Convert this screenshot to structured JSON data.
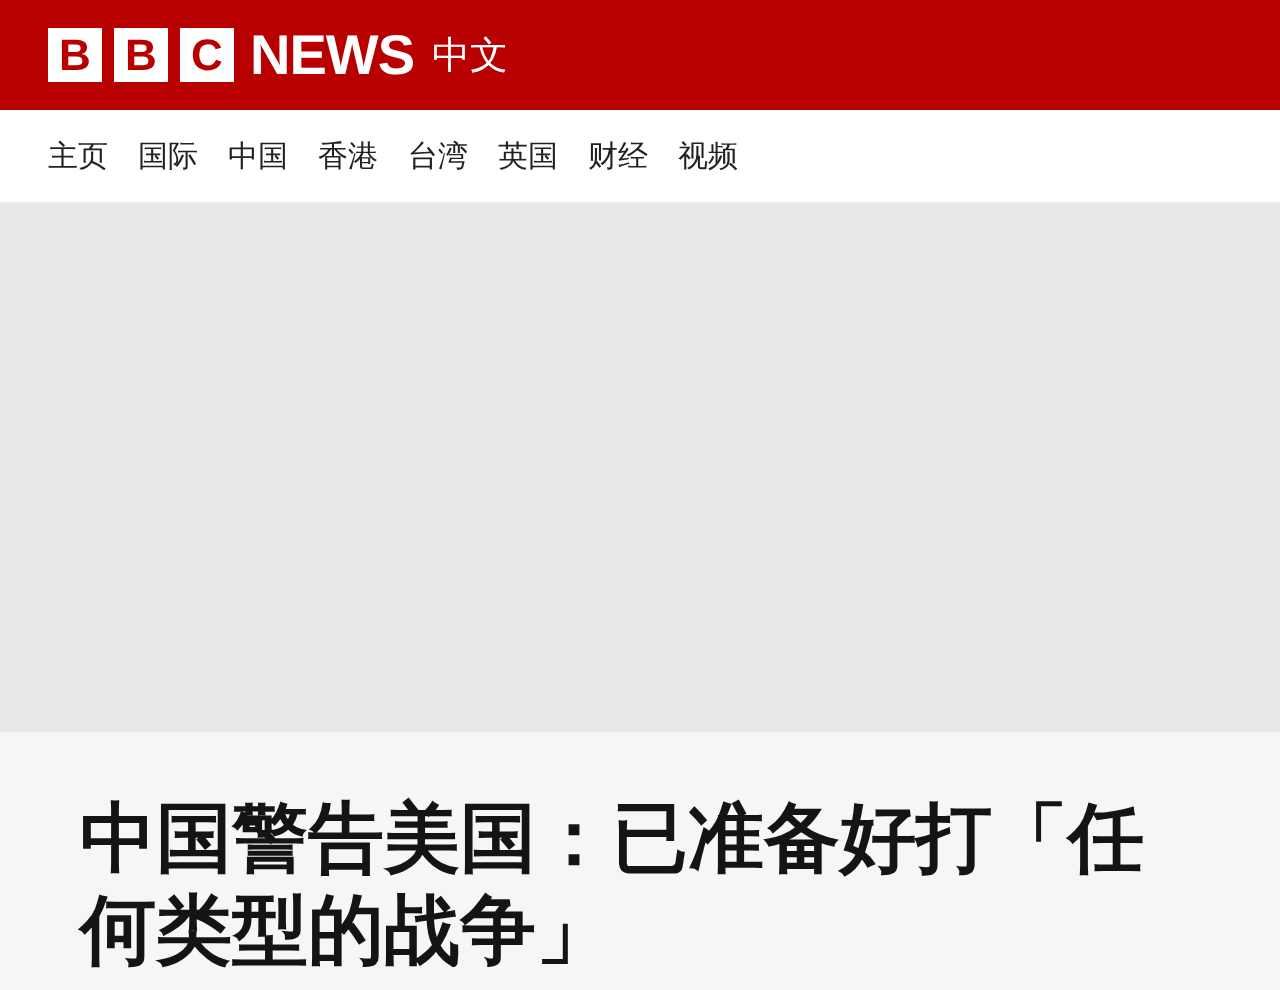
{
  "header": {
    "logo_letters": [
      "B",
      "B",
      "C"
    ],
    "logo_word": "NEWS",
    "edition": "中文"
  },
  "nav": [
    {
      "label": "主页"
    },
    {
      "label": "国际"
    },
    {
      "label": "中国"
    },
    {
      "label": "香港"
    },
    {
      "label": "台湾"
    },
    {
      "label": "英国"
    },
    {
      "label": "财经"
    },
    {
      "label": "视频"
    }
  ],
  "article": {
    "image": {
      "kind": "placeholder"
    },
    "headline": "中国警告美国：已准备好打「任何类型的战争」"
  }
}
